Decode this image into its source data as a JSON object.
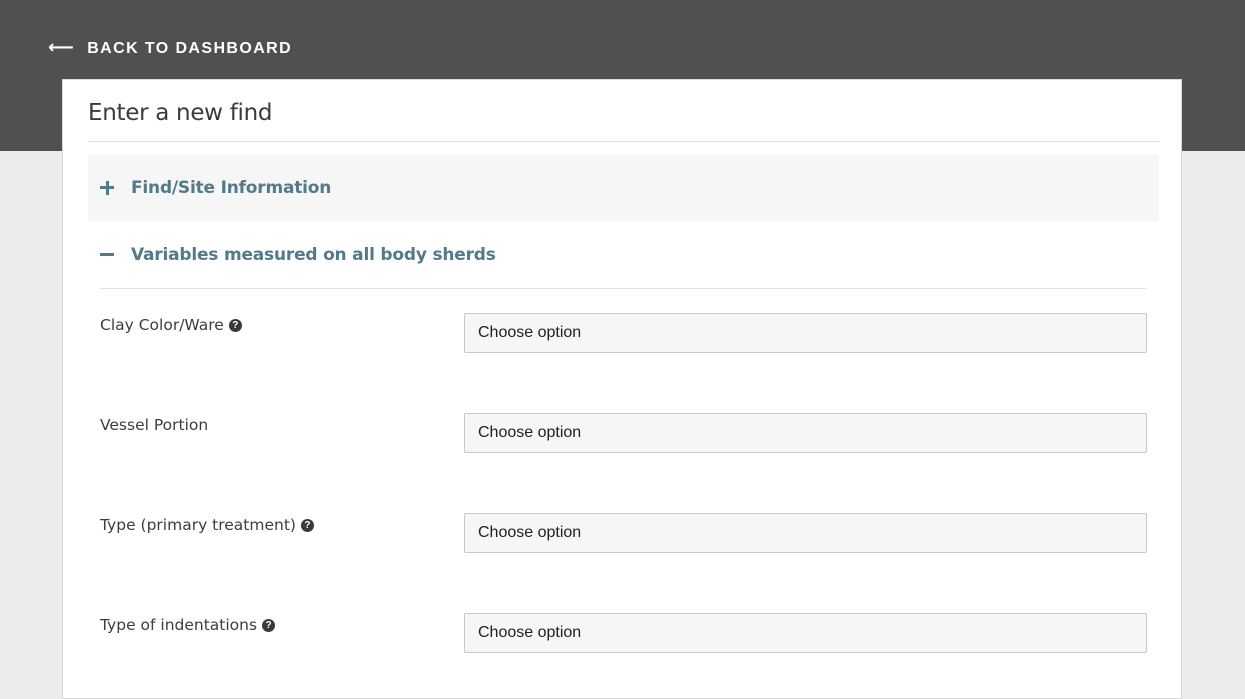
{
  "nav": {
    "back_label": "BACK TO DASHBOARD",
    "back_icon": "arrow-left-icon"
  },
  "form": {
    "title": "Enter a new find",
    "sections": [
      {
        "label": "Find/Site Information",
        "state": "collapsed",
        "icon": "plus-icon"
      },
      {
        "label": "Variables measured on all body sherds",
        "state": "expanded",
        "icon": "minus-icon"
      }
    ],
    "fields": [
      {
        "label": "Clay Color/Ware",
        "has_help": true,
        "value": "Choose option"
      },
      {
        "label": "Vessel Portion",
        "has_help": false,
        "value": "Choose option"
      },
      {
        "label": "Type (primary treatment)",
        "has_help": true,
        "value": "Choose option"
      },
      {
        "label": "Type of indentations",
        "has_help": true,
        "value": "Choose option"
      }
    ]
  },
  "colors": {
    "topbar": "#505050",
    "accent": "#527a8a",
    "page_bg": "#ececec"
  }
}
